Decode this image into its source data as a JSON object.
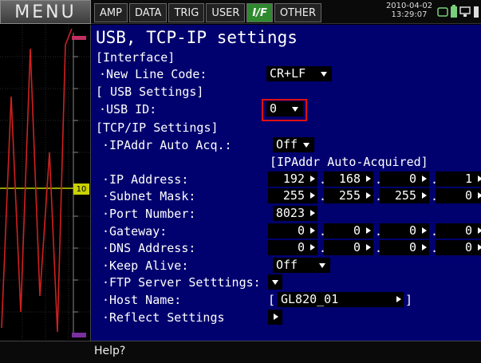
{
  "menu": {
    "label": "MENU"
  },
  "tabs": [
    {
      "label": "AMP",
      "active": false
    },
    {
      "label": "DATA",
      "active": false
    },
    {
      "label": "TRIG",
      "active": false
    },
    {
      "label": "USER",
      "active": false
    },
    {
      "label": "I/F",
      "active": true
    },
    {
      "label": "OTHER",
      "active": false
    }
  ],
  "datetime": {
    "date": "2010-04-02",
    "time": "13:29:07"
  },
  "status_icons": [
    "memory-card-icon",
    "battery-icon",
    "network-icon",
    "usb-icon"
  ],
  "waveform": {
    "marker_label": "10"
  },
  "settings": {
    "title": "USB, TCP-IP settings",
    "interface": {
      "header": "[Interface]",
      "new_line_code_label": "·New Line Code:",
      "new_line_code_value": "CR+LF"
    },
    "usb": {
      "header": "[ USB Settings]",
      "usb_id_label": "·USB ID:",
      "usb_id_value": "0"
    },
    "tcpip": {
      "header": "[TCP/IP Settings]",
      "auto_acq_label": "·IPAddr Auto Acq.:",
      "auto_acq_value": "Off",
      "auto_acquired_note": "[IPAddr Auto-Acquired]",
      "ip_address_label": "·IP Address:",
      "ip_address": [
        "192",
        "168",
        "0",
        "1"
      ],
      "subnet_mask_label": "·Subnet Mask:",
      "subnet_mask": [
        "255",
        "255",
        "255",
        "0"
      ],
      "port_number_label": "·Port Number:",
      "port_number_value": "8023",
      "gateway_label": "·Gateway:",
      "gateway": [
        "0",
        "0",
        "0",
        "0"
      ],
      "dns_label": "·DNS Address:",
      "dns": [
        "0",
        "0",
        "0",
        "0"
      ],
      "keep_alive_label": "·Keep Alive:",
      "keep_alive_value": "Off",
      "ftp_label": "·FTP Server Setttings:",
      "host_name_label": "·Host Name:",
      "host_name_value": "GL820_01",
      "reflect_label": "·Reflect Settings"
    }
  },
  "help": {
    "text": "Help?"
  },
  "colors": {
    "settings_bg": "#00006e",
    "active_tab": "#2f8a2f",
    "highlight": "#e01010",
    "wave": "#d02020",
    "wave_marker": "#c8d200"
  }
}
